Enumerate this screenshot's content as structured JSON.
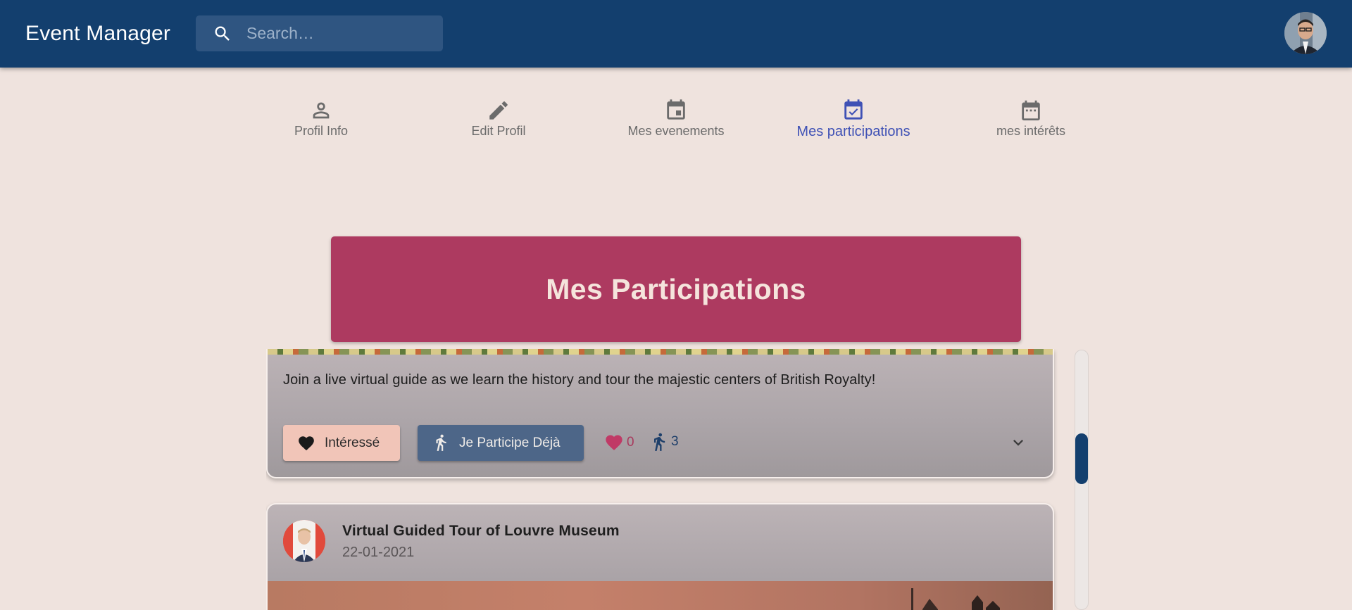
{
  "app": {
    "title": "Event Manager"
  },
  "search": {
    "placeholder": "Search…",
    "icon": "search-icon"
  },
  "tabs": [
    {
      "label": "Profil Info",
      "icon": "person-icon",
      "active": false
    },
    {
      "label": "Edit Profil",
      "icon": "pencil-icon",
      "active": false
    },
    {
      "label": "Mes evenements",
      "icon": "calendar-icon",
      "active": false
    },
    {
      "label": "Mes participations",
      "icon": "calendar-check-icon",
      "active": true
    },
    {
      "label": "mes intérêts",
      "icon": "calendar-dots-icon",
      "active": false
    }
  ],
  "page": {
    "heading": "Mes Participations"
  },
  "events": [
    {
      "description": "Join a live virtual guide as we learn the history and tour the majestic centers of British Royalty!",
      "interested_label": "Intéressé",
      "participate_label": "Je Participe Déjà",
      "likes": "0",
      "participants": "3"
    },
    {
      "title": "Virtual Guided Tour of Louvre Museum",
      "date": "22-01-2021"
    }
  ],
  "colors": {
    "appbar": "#133f6e",
    "heading_card": "#ad3a60",
    "active_tab": "#3f51b5",
    "interested_button": "#f1c5b8",
    "participate_button": "#4d6688",
    "like": "#a83a5d"
  }
}
